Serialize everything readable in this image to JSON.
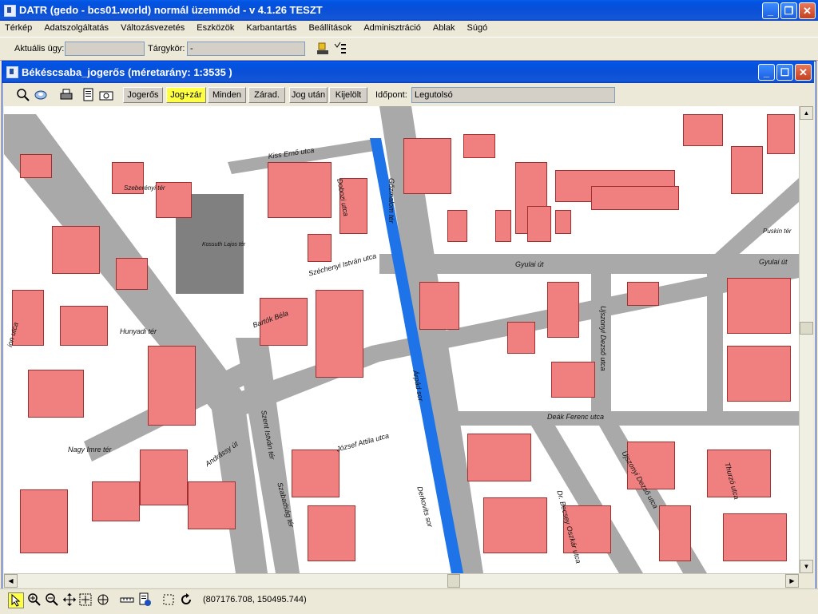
{
  "app": {
    "title": "DATR (gedo - bcs01.world) normál üzemmód - v 4.1.26 TESZT"
  },
  "menu": [
    "Térkép",
    "Adatszolgáltatás",
    "Változásvezetés",
    "Eszközök",
    "Karbantartás",
    "Beállítások",
    "Adminisztráció",
    "Ablak",
    "Súgó"
  ],
  "toolbar": {
    "case_label": "Aktuális ügy:",
    "case_value": "",
    "subject_label": "Tárgykör:",
    "subject_value": "-"
  },
  "map_window": {
    "title": "Békéscsaba_jogerős  (méretarány: 1:3535 )",
    "filters": [
      "Jogerős",
      "Jog+zár",
      "Minden",
      "Zárad.",
      "Jog után",
      "Kijelölt"
    ],
    "active_filter": "Jog+zár",
    "time_label": "Időpont:",
    "time_value": "Legutolsó"
  },
  "map_labels": {
    "szent_istvan_ter": "Szent István tér",
    "gyulai_ut_1": "Gyulai út",
    "gyulai_ut_2": "Gyulai út",
    "deak_ferenc_utca": "Deák Ferenc utca",
    "arpad_sor": "Árpád sor",
    "uszonyi_dezso_utca_1": "Ujszonyi Dezső utca",
    "uszonyi_dezso_utca_2": "Ujszonyi Dezső utca",
    "andrassy_ut": "Andrássy út",
    "jozsef_attila_utca": "József Attila utca",
    "szechenyi_istvan_utca": "Széchenyi István utca",
    "kiss_erno_utca": "Kiss Ernő utca",
    "dorottya_utca": "Dobozi utca",
    "szabadsag_ter": "Szabadság tér",
    "kossuth_lajos_ter": "Kossuth Lajos tér",
    "hunyadi_ter": "Hunyadi tér",
    "nagy_imre": "Nagy Imre tér",
    "derkovits_sor": "Derkovits sor",
    "thurzo_utca": "Thurzó utca",
    "dr_becsey_oszkar_utca": "Dr. Becsey Oszkár utca",
    "gozmalom_ter": "Gőzmalom tér",
    "szeberenyi_ter": "Szeberényi tér",
    "bartok_bela": "Bartók Béla",
    "puskin_ter": "Puskin tér",
    "ion_utca": "ion utca"
  },
  "status": {
    "coordinates": "(807176.708, 150495.744)"
  },
  "colors": {
    "building": "#f08080",
    "street": "#a9a9a9",
    "canal": "#1e73e8",
    "highlight": "#ffff44"
  }
}
